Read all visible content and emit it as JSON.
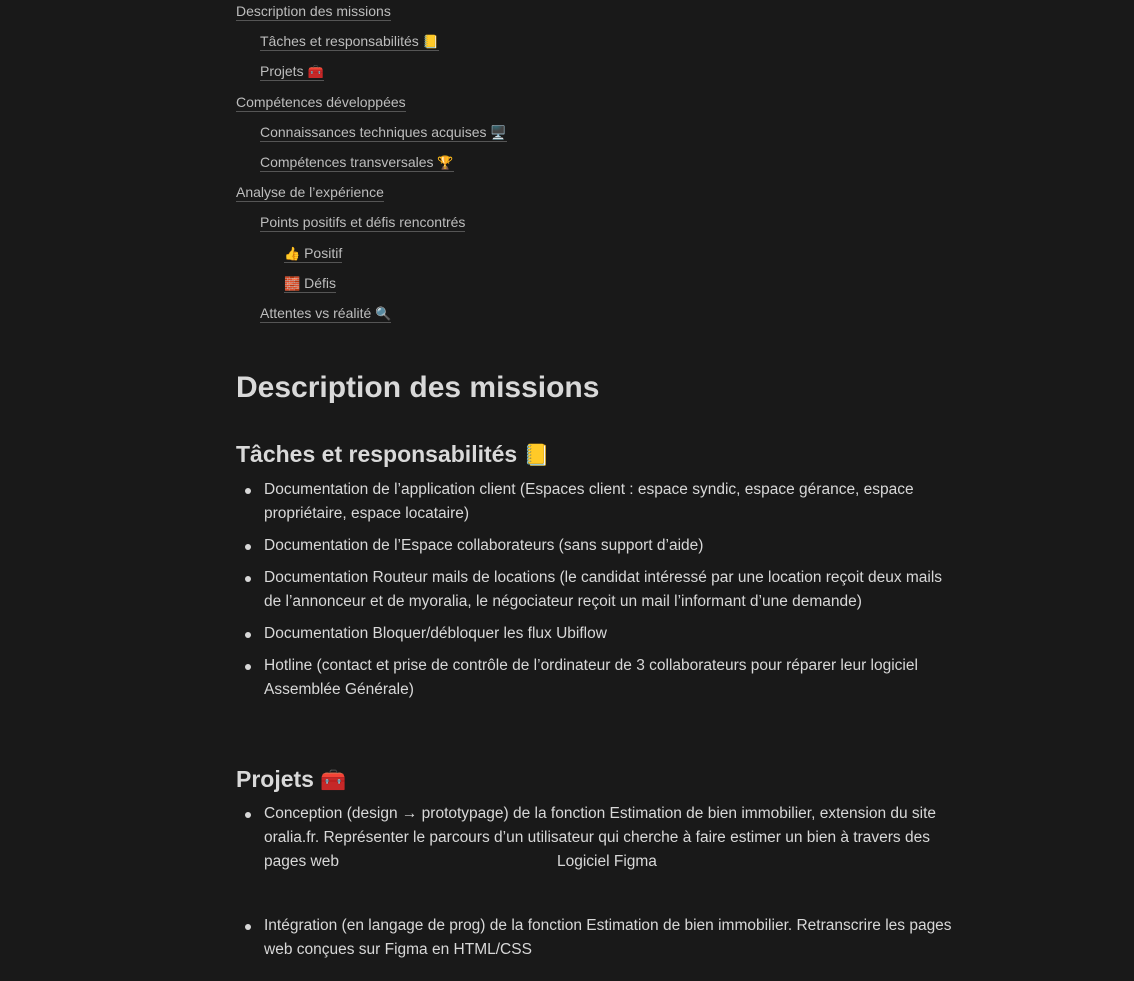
{
  "toc": {
    "items": [
      {
        "label": "Description des missions",
        "emoji": ""
      },
      {
        "label": "Tâches et responsabilités",
        "emoji": "📒"
      },
      {
        "label": "Projets",
        "emoji": "🧰"
      },
      {
        "label": "Compétences développées",
        "emoji": ""
      },
      {
        "label": "Connaissances techniques acquises",
        "emoji": "🖥️"
      },
      {
        "label": "Compétences transversales",
        "emoji": "🏆"
      },
      {
        "label": "Analyse de l’expérience",
        "emoji": ""
      },
      {
        "label": "Points positifs et défis rencontrés",
        "emoji": ""
      },
      {
        "label": "Positif",
        "emoji": "👍"
      },
      {
        "label": "Défis",
        "emoji": "🧱"
      },
      {
        "label": "Attentes vs réalité",
        "emoji": "🔍"
      }
    ]
  },
  "content": {
    "h1": "Description des missions",
    "taches": {
      "title": "Tâches et responsabilités",
      "emoji": "📒",
      "bullets": [
        "Documentation de l’application client (Espaces client : espace syndic, espace gérance, espace propriétaire, espace locataire)",
        "Documentation de l’Espace collaborateurs (sans support d’aide)",
        "Documentation Routeur mails de locations (le candidat intéressé par une location reçoit deux mails de l’annonceur et de myoralia, le négociateur reçoit un mail l’informant d’une demande)",
        "Documentation Bloquer/débloquer les flux Ubiflow",
        "Hotline (contact et prise de contrôle de l’ordinateur de 3 collaborateurs pour réparer leur logiciel Assemblée Générale)"
      ]
    },
    "projets": {
      "title": "Projets",
      "emoji": "🧰",
      "bullet1_text": "Conception (design → prototypage) de la fonction Estimation de bien immobilier, extension du site oralia.fr. Représenter le parcours d’un utilisateur qui cherche à faire estimer un bien à travers des pages web",
      "bullet1_tool": "Logiciel Figma",
      "bullet2_text": "Intégration (en langage de prog) de la fonction Estimation de bien immobilier. Retranscrire les pages web conçues sur Figma en HTML/CSS"
    }
  }
}
